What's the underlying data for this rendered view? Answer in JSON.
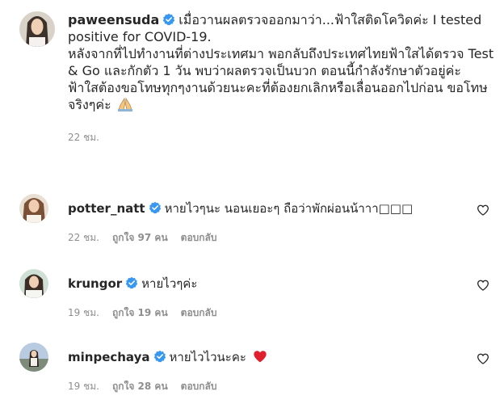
{
  "post": {
    "username": "paweensuda",
    "caption": "เมื่อวานผลตรวจออกมาว่า...ฟ้าใสติดโควิดค่ะ I tested positive for COVID-19.\nหลังจากที่ไปทำงานที่ต่างประเทศมา พอกลับถึงประเทศไทยฟ้าใสได้ตรวจ Test & Go และกักตัว 1 วัน พบว่าผลตรวจเป็นบวก ตอนนี้กำลังรักษาตัวอยู่ค่ะ\nฟ้าใสต้องขอโทษทุกๆงานด้วยนะคะที่ต้องยกเลิกหรือเลื่อนออกไปก่อน ขอโทษจริงๆค่ะ",
    "emoji": "pray",
    "time": "22 ชม."
  },
  "comments": [
    {
      "username": "potter_natt",
      "text": "หายไวๆนะ นอนเยอะๆ ถือว่าพักผ่อนน้าาา□□□",
      "time": "22 ชม.",
      "likes": "ถูกใจ 97 คน",
      "reply": "ตอบกลับ"
    },
    {
      "username": "krungor",
      "text": "หายไวๆค่ะ",
      "time": "19 ชม.",
      "likes": "ถูกใจ 19 คน",
      "reply": "ตอบกลับ"
    },
    {
      "username": "minpechaya",
      "text": "หายไวไวนะคะ",
      "emoji": "red-heart",
      "time": "19 ชม.",
      "likes": "ถูกใจ 28 คน",
      "reply": "ตอบกลับ"
    }
  ],
  "colors": {
    "verified": "#3897f0",
    "meta": "#8e8e8e",
    "text": "#262626",
    "heart": "#ed4956"
  }
}
